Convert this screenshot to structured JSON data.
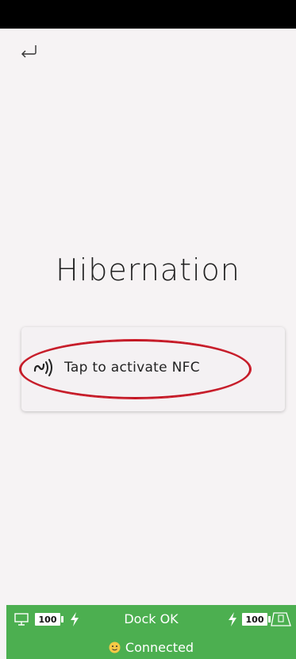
{
  "header": {
    "back_label": "back"
  },
  "page": {
    "title": "Hibernation"
  },
  "nfc": {
    "label": "Tap to activate NFC"
  },
  "footer": {
    "monitor_battery": "100",
    "dock_status": "Dock OK",
    "phone_battery": "100",
    "connection": "Connected",
    "bg_color": "#4caf50"
  },
  "colors": {
    "highlight": "#c0121f",
    "background": "#f6f3f4"
  }
}
